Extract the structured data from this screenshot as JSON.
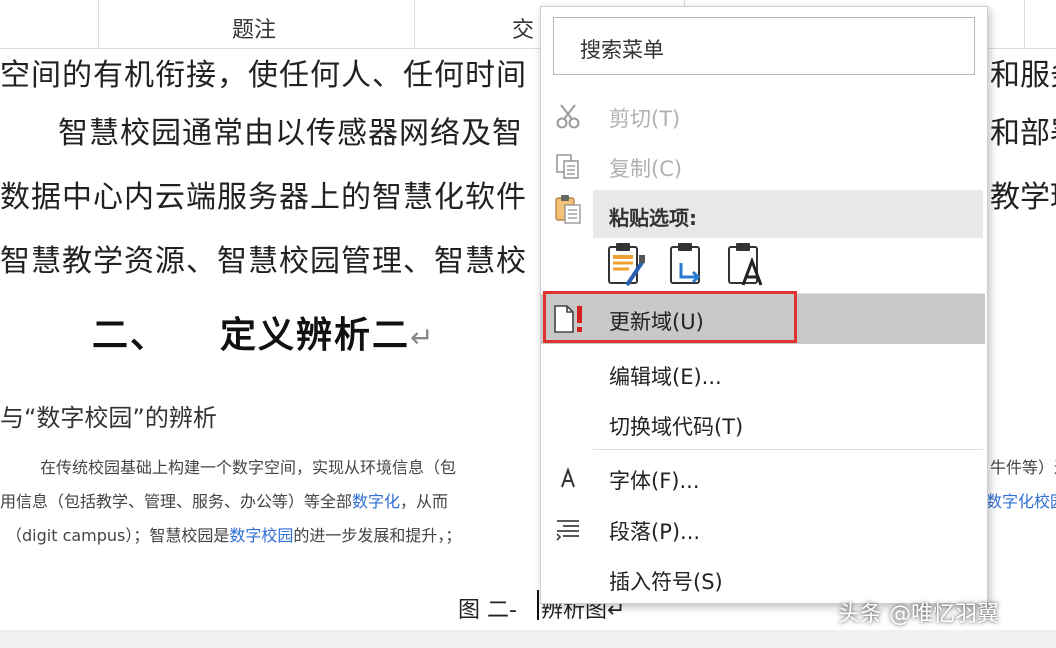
{
  "document": {
    "header_cells": [
      "题注",
      "交"
    ],
    "lines": [
      "空间的有机衔接，使任何人、任何时间",
      "智慧校园通常由以传感器网络及智",
      "数据中心内云端服务器上的智慧化软件",
      "智慧教学资源、智慧校园管理、智慧校"
    ],
    "lines_right": [
      "和服务",
      "和部署",
      "教学环",
      ""
    ],
    "heading_number": "二、",
    "heading_text": "定义辨析二",
    "paragraph_mark": "↵",
    "subheading": "与“数字校园”的辨析",
    "small_line1": "在传统校园基础上构建一个数字空间，实现从环境信息（包",
    "small_line1_right": "牛件等）进",
    "small_line2_prefix": "用信息（包括教学、管理、服务、办公等）等全部",
    "small_line2_link": "数字化",
    "small_line2_suffix": "，从而",
    "small_line2_right_link": "数字化校园",
    "small_line3_prefix": "（digit campus）；智慧校园是",
    "small_line3_link": "数字校园",
    "small_line3_suffix": "的进一步发展和提升，；",
    "figure_caption_left": "图 二-",
    "figure_caption_right": "辨析图↵"
  },
  "context_menu": {
    "search_placeholder": "搜索菜单",
    "items": [
      {
        "label": "剪切(T)",
        "icon": "scissors-icon",
        "disabled": true
      },
      {
        "label": "复制(C)",
        "icon": "copy-icon",
        "disabled": true
      },
      {
        "label": "粘贴选项:",
        "icon": "paste-icon",
        "header": true
      },
      {
        "label": "更新域(U)",
        "icon": "update-field-icon",
        "highlighted": true
      },
      {
        "label": "编辑域(E)...",
        "icon": "",
        "disabled": false
      },
      {
        "label": "切换域代码(T)",
        "icon": "",
        "disabled": false
      },
      {
        "label": "字体(F)...",
        "icon": "font-icon",
        "disabled": false
      },
      {
        "label": "段落(P)...",
        "icon": "paragraph-icon",
        "disabled": false
      },
      {
        "label": "插入符号(S)",
        "icon": "",
        "disabled": false
      }
    ],
    "paste_options": [
      "keep-source-formatting-icon",
      "merge-formatting-icon",
      "keep-text-only-icon"
    ],
    "highlight_color": "#c8c8c8",
    "annotation_color": "#e03434"
  },
  "watermark": "头条 @唯忆羽翼"
}
